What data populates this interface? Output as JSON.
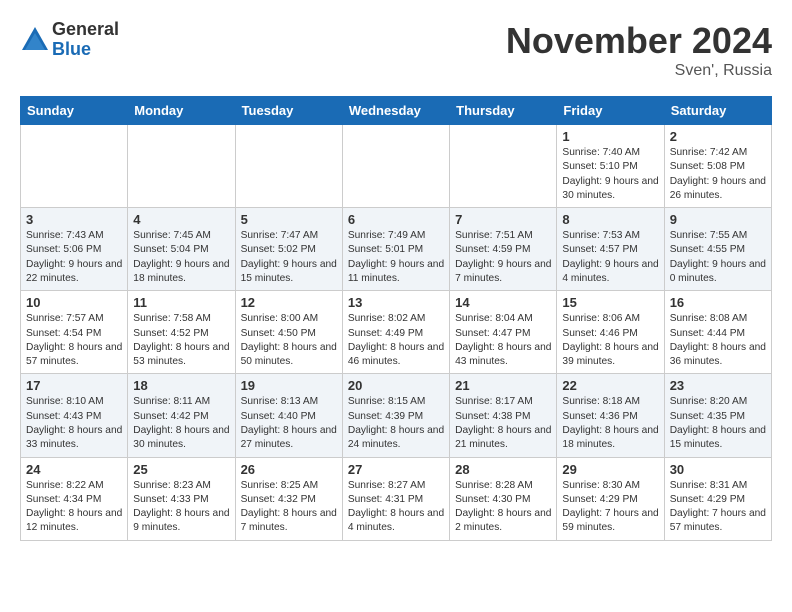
{
  "logo": {
    "general": "General",
    "blue": "Blue"
  },
  "title": "November 2024",
  "location": "Sven', Russia",
  "days_header": [
    "Sunday",
    "Monday",
    "Tuesday",
    "Wednesday",
    "Thursday",
    "Friday",
    "Saturday"
  ],
  "weeks": [
    [
      {
        "day": "",
        "info": ""
      },
      {
        "day": "",
        "info": ""
      },
      {
        "day": "",
        "info": ""
      },
      {
        "day": "",
        "info": ""
      },
      {
        "day": "",
        "info": ""
      },
      {
        "day": "1",
        "info": "Sunrise: 7:40 AM\nSunset: 5:10 PM\nDaylight: 9 hours and 30 minutes."
      },
      {
        "day": "2",
        "info": "Sunrise: 7:42 AM\nSunset: 5:08 PM\nDaylight: 9 hours and 26 minutes."
      }
    ],
    [
      {
        "day": "3",
        "info": "Sunrise: 7:43 AM\nSunset: 5:06 PM\nDaylight: 9 hours and 22 minutes."
      },
      {
        "day": "4",
        "info": "Sunrise: 7:45 AM\nSunset: 5:04 PM\nDaylight: 9 hours and 18 minutes."
      },
      {
        "day": "5",
        "info": "Sunrise: 7:47 AM\nSunset: 5:02 PM\nDaylight: 9 hours and 15 minutes."
      },
      {
        "day": "6",
        "info": "Sunrise: 7:49 AM\nSunset: 5:01 PM\nDaylight: 9 hours and 11 minutes."
      },
      {
        "day": "7",
        "info": "Sunrise: 7:51 AM\nSunset: 4:59 PM\nDaylight: 9 hours and 7 minutes."
      },
      {
        "day": "8",
        "info": "Sunrise: 7:53 AM\nSunset: 4:57 PM\nDaylight: 9 hours and 4 minutes."
      },
      {
        "day": "9",
        "info": "Sunrise: 7:55 AM\nSunset: 4:55 PM\nDaylight: 9 hours and 0 minutes."
      }
    ],
    [
      {
        "day": "10",
        "info": "Sunrise: 7:57 AM\nSunset: 4:54 PM\nDaylight: 8 hours and 57 minutes."
      },
      {
        "day": "11",
        "info": "Sunrise: 7:58 AM\nSunset: 4:52 PM\nDaylight: 8 hours and 53 minutes."
      },
      {
        "day": "12",
        "info": "Sunrise: 8:00 AM\nSunset: 4:50 PM\nDaylight: 8 hours and 50 minutes."
      },
      {
        "day": "13",
        "info": "Sunrise: 8:02 AM\nSunset: 4:49 PM\nDaylight: 8 hours and 46 minutes."
      },
      {
        "day": "14",
        "info": "Sunrise: 8:04 AM\nSunset: 4:47 PM\nDaylight: 8 hours and 43 minutes."
      },
      {
        "day": "15",
        "info": "Sunrise: 8:06 AM\nSunset: 4:46 PM\nDaylight: 8 hours and 39 minutes."
      },
      {
        "day": "16",
        "info": "Sunrise: 8:08 AM\nSunset: 4:44 PM\nDaylight: 8 hours and 36 minutes."
      }
    ],
    [
      {
        "day": "17",
        "info": "Sunrise: 8:10 AM\nSunset: 4:43 PM\nDaylight: 8 hours and 33 minutes."
      },
      {
        "day": "18",
        "info": "Sunrise: 8:11 AM\nSunset: 4:42 PM\nDaylight: 8 hours and 30 minutes."
      },
      {
        "day": "19",
        "info": "Sunrise: 8:13 AM\nSunset: 4:40 PM\nDaylight: 8 hours and 27 minutes."
      },
      {
        "day": "20",
        "info": "Sunrise: 8:15 AM\nSunset: 4:39 PM\nDaylight: 8 hours and 24 minutes."
      },
      {
        "day": "21",
        "info": "Sunrise: 8:17 AM\nSunset: 4:38 PM\nDaylight: 8 hours and 21 minutes."
      },
      {
        "day": "22",
        "info": "Sunrise: 8:18 AM\nSunset: 4:36 PM\nDaylight: 8 hours and 18 minutes."
      },
      {
        "day": "23",
        "info": "Sunrise: 8:20 AM\nSunset: 4:35 PM\nDaylight: 8 hours and 15 minutes."
      }
    ],
    [
      {
        "day": "24",
        "info": "Sunrise: 8:22 AM\nSunset: 4:34 PM\nDaylight: 8 hours and 12 minutes."
      },
      {
        "day": "25",
        "info": "Sunrise: 8:23 AM\nSunset: 4:33 PM\nDaylight: 8 hours and 9 minutes."
      },
      {
        "day": "26",
        "info": "Sunrise: 8:25 AM\nSunset: 4:32 PM\nDaylight: 8 hours and 7 minutes."
      },
      {
        "day": "27",
        "info": "Sunrise: 8:27 AM\nSunset: 4:31 PM\nDaylight: 8 hours and 4 minutes."
      },
      {
        "day": "28",
        "info": "Sunrise: 8:28 AM\nSunset: 4:30 PM\nDaylight: 8 hours and 2 minutes."
      },
      {
        "day": "29",
        "info": "Sunrise: 8:30 AM\nSunset: 4:29 PM\nDaylight: 7 hours and 59 minutes."
      },
      {
        "day": "30",
        "info": "Sunrise: 8:31 AM\nSunset: 4:29 PM\nDaylight: 7 hours and 57 minutes."
      }
    ]
  ]
}
